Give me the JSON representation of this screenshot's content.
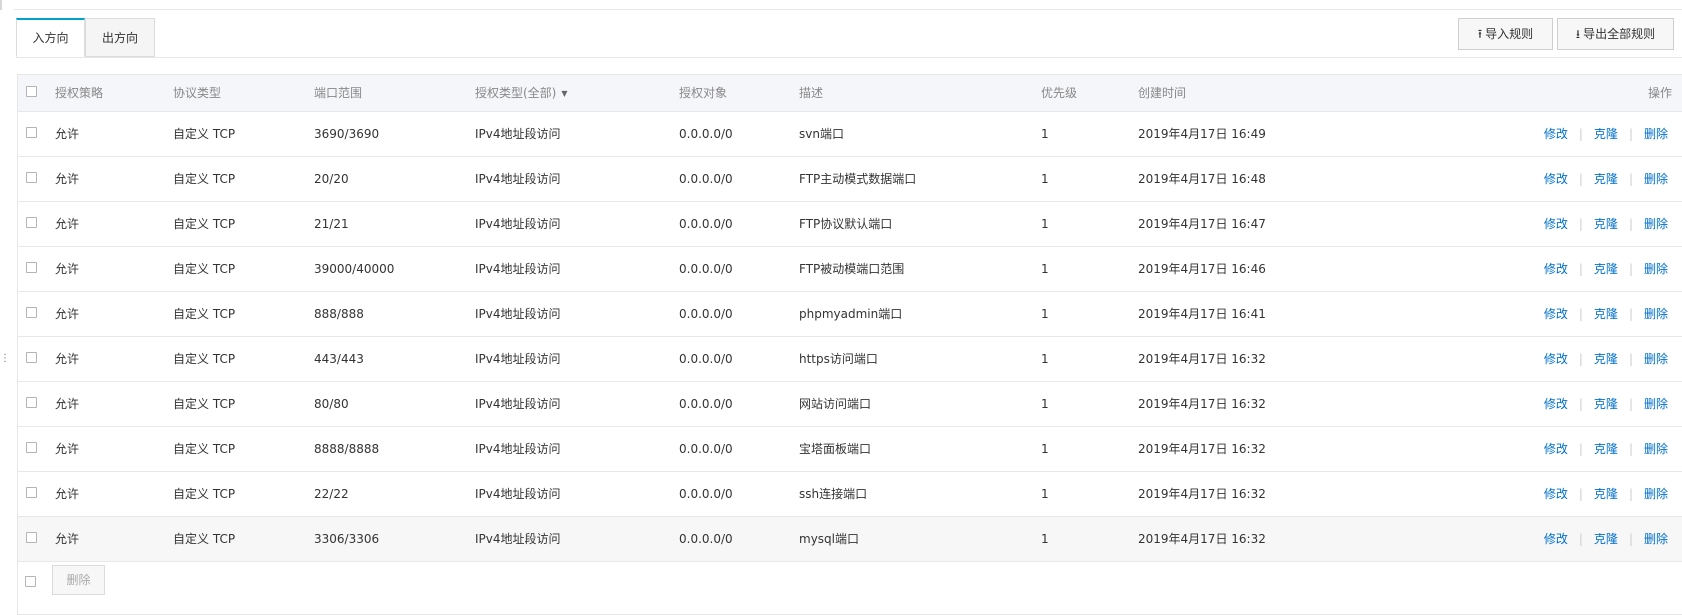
{
  "tabs": [
    {
      "label": "入方向",
      "active": true
    },
    {
      "label": "出方向",
      "active": false
    }
  ],
  "toolbar": {
    "import_label": "导入规则",
    "export_label": "导出全部规则",
    "import_icon": "upload-icon",
    "export_icon": "download-icon"
  },
  "table": {
    "headers": {
      "policy": "授权策略",
      "protocol": "协议类型",
      "port": "端口范围",
      "auth_type": "授权类型(全部)",
      "auth_object": "授权对象",
      "description": "描述",
      "priority": "优先级",
      "created": "创建时间",
      "actions": "操作"
    },
    "action_labels": {
      "edit": "修改",
      "clone": "克隆",
      "delete": "删除"
    },
    "rows": [
      {
        "policy": "允许",
        "protocol": "自定义 TCP",
        "port": "3690/3690",
        "auth_type": "IPv4地址段访问",
        "auth_object": "0.0.0.0/0",
        "description": "svn端口",
        "priority": "1",
        "created": "2019年4月17日 16:49"
      },
      {
        "policy": "允许",
        "protocol": "自定义 TCP",
        "port": "20/20",
        "auth_type": "IPv4地址段访问",
        "auth_object": "0.0.0.0/0",
        "description": "FTP主动模式数据端口",
        "priority": "1",
        "created": "2019年4月17日 16:48"
      },
      {
        "policy": "允许",
        "protocol": "自定义 TCP",
        "port": "21/21",
        "auth_type": "IPv4地址段访问",
        "auth_object": "0.0.0.0/0",
        "description": "FTP协议默认端口",
        "priority": "1",
        "created": "2019年4月17日 16:47"
      },
      {
        "policy": "允许",
        "protocol": "自定义 TCP",
        "port": "39000/40000",
        "auth_type": "IPv4地址段访问",
        "auth_object": "0.0.0.0/0",
        "description": "FTP被动模端口范围",
        "priority": "1",
        "created": "2019年4月17日 16:46"
      },
      {
        "policy": "允许",
        "protocol": "自定义 TCP",
        "port": "888/888",
        "auth_type": "IPv4地址段访问",
        "auth_object": "0.0.0.0/0",
        "description": "phpmyadmin端口",
        "priority": "1",
        "created": "2019年4月17日 16:41"
      },
      {
        "policy": "允许",
        "protocol": "自定义 TCP",
        "port": "443/443",
        "auth_type": "IPv4地址段访问",
        "auth_object": "0.0.0.0/0",
        "description": "https访问端口",
        "priority": "1",
        "created": "2019年4月17日 16:32"
      },
      {
        "policy": "允许",
        "protocol": "自定义 TCP",
        "port": "80/80",
        "auth_type": "IPv4地址段访问",
        "auth_object": "0.0.0.0/0",
        "description": "网站访问端口",
        "priority": "1",
        "created": "2019年4月17日 16:32"
      },
      {
        "policy": "允许",
        "protocol": "自定义 TCP",
        "port": "8888/8888",
        "auth_type": "IPv4地址段访问",
        "auth_object": "0.0.0.0/0",
        "description": "宝塔面板端口",
        "priority": "1",
        "created": "2019年4月17日 16:32"
      },
      {
        "policy": "允许",
        "protocol": "自定义 TCP",
        "port": "22/22",
        "auth_type": "IPv4地址段访问",
        "auth_object": "0.0.0.0/0",
        "description": "ssh连接端口",
        "priority": "1",
        "created": "2019年4月17日 16:32"
      },
      {
        "policy": "允许",
        "protocol": "自定义 TCP",
        "port": "3306/3306",
        "auth_type": "IPv4地址段访问",
        "auth_object": "0.0.0.0/0",
        "description": "mysql端口",
        "priority": "1",
        "created": "2019年4月17日 16:32"
      }
    ]
  },
  "footer": {
    "delete_label": "删除"
  },
  "colors": {
    "accent": "#00a2ca",
    "link": "#0070cc",
    "header_bg": "#f5f6fa"
  }
}
